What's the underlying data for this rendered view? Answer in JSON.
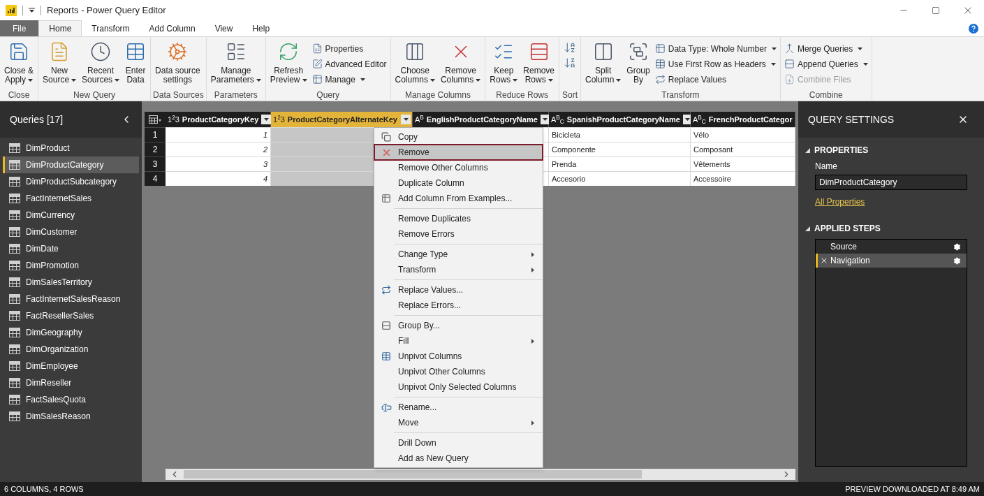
{
  "window": {
    "title": "Reports - Power Query Editor"
  },
  "tabs": [
    {
      "label": "File",
      "kind": "file",
      "selected": false
    },
    {
      "label": "Home",
      "kind": "tab",
      "selected": true
    },
    {
      "label": "Transform",
      "kind": "tab",
      "selected": false
    },
    {
      "label": "Add Column",
      "kind": "tab",
      "selected": false
    },
    {
      "label": "View",
      "kind": "tab",
      "selected": false
    },
    {
      "label": "Help",
      "kind": "tab",
      "selected": false
    }
  ],
  "ribbon": [
    {
      "label": "Close",
      "items": [
        {
          "kind": "large",
          "lines": [
            "Close &",
            "Apply"
          ],
          "dropdown": true
        }
      ]
    },
    {
      "label": "New Query",
      "items": [
        {
          "kind": "large",
          "lines": [
            "New",
            "Source"
          ],
          "dropdown": true
        },
        {
          "kind": "large",
          "lines": [
            "Recent",
            "Sources"
          ],
          "dropdown": true
        },
        {
          "kind": "large",
          "lines": [
            "Enter",
            "Data"
          ],
          "dropdown": false
        }
      ]
    },
    {
      "label": "Data Sources",
      "items": [
        {
          "kind": "large",
          "lines": [
            "Data source",
            "settings"
          ],
          "dropdown": false
        }
      ]
    },
    {
      "label": "Parameters",
      "items": [
        {
          "kind": "large",
          "lines": [
            "Manage",
            "Parameters"
          ],
          "dropdown": true
        }
      ]
    },
    {
      "label": "Query",
      "items": [
        {
          "kind": "large",
          "lines": [
            "Refresh",
            "Preview"
          ],
          "dropdown": true
        },
        {
          "kind": "stack",
          "small": [
            {
              "label": "Properties",
              "dropdown": false,
              "disabled": false
            },
            {
              "label": "Advanced Editor",
              "dropdown": false,
              "disabled": false
            },
            {
              "label": "Manage",
              "dropdown": true,
              "disabled": false
            }
          ]
        }
      ]
    },
    {
      "label": "Manage Columns",
      "items": [
        {
          "kind": "large",
          "lines": [
            "Choose",
            "Columns"
          ],
          "dropdown": true
        },
        {
          "kind": "large",
          "lines": [
            "Remove",
            "Columns"
          ],
          "dropdown": true
        }
      ]
    },
    {
      "label": "Reduce Rows",
      "items": [
        {
          "kind": "large",
          "lines": [
            "Keep",
            "Rows"
          ],
          "dropdown": true
        },
        {
          "kind": "large",
          "lines": [
            "Remove",
            "Rows"
          ],
          "dropdown": true
        }
      ]
    },
    {
      "label": "Sort",
      "items": [
        {
          "kind": "sort"
        }
      ]
    },
    {
      "label": "Transform",
      "items": [
        {
          "kind": "large",
          "lines": [
            "Split",
            "Column"
          ],
          "dropdown": true
        },
        {
          "kind": "large",
          "lines": [
            "Group",
            "By"
          ],
          "dropdown": false
        },
        {
          "kind": "stack",
          "small": [
            {
              "label": "Data Type: Whole Number",
              "dropdown": true,
              "disabled": false
            },
            {
              "label": "Use First Row as Headers",
              "dropdown": true,
              "disabled": false
            },
            {
              "label": "Replace Values",
              "dropdown": false,
              "disabled": false
            }
          ]
        }
      ]
    },
    {
      "label": "Combine",
      "items": [
        {
          "kind": "stack",
          "small": [
            {
              "label": "Merge Queries",
              "dropdown": true,
              "disabled": false
            },
            {
              "label": "Append Queries",
              "dropdown": true,
              "disabled": false
            },
            {
              "label": "Combine Files",
              "dropdown": false,
              "disabled": true
            }
          ]
        }
      ]
    }
  ],
  "queries": {
    "title": "Queries [17]",
    "items": [
      {
        "name": "DimProduct",
        "selected": false
      },
      {
        "name": "DimProductCategory",
        "selected": true
      },
      {
        "name": "DimProductSubcategory",
        "selected": false
      },
      {
        "name": "FactInternetSales",
        "selected": false
      },
      {
        "name": "DimCurrency",
        "selected": false
      },
      {
        "name": "DimCustomer",
        "selected": false
      },
      {
        "name": "DimDate",
        "selected": false
      },
      {
        "name": "DimPromotion",
        "selected": false
      },
      {
        "name": "DimSalesTerritory",
        "selected": false
      },
      {
        "name": "FactInternetSalesReason",
        "selected": false
      },
      {
        "name": "FactResellerSales",
        "selected": false
      },
      {
        "name": "DimGeography",
        "selected": false
      },
      {
        "name": "DimOrganization",
        "selected": false
      },
      {
        "name": "DimEmployee",
        "selected": false
      },
      {
        "name": "DimReseller",
        "selected": false
      },
      {
        "name": "FactSalesQuota",
        "selected": false
      },
      {
        "name": "DimSalesReason",
        "selected": false
      }
    ]
  },
  "table": {
    "columns": [
      {
        "type_label": "1$^{2}$3",
        "name": "ProductCategoryKey",
        "selected": false
      },
      {
        "type_label": "1$^{2}$3",
        "name": "ProductCategoryAlternateKey",
        "selected": true
      },
      {
        "type_label": "A$^{B}$",
        "name": "EnglishProductCategoryName",
        "selected": false
      },
      {
        "type_label": "A$^{B}$$_{C}$",
        "name": "SpanishProductCategoryName",
        "selected": false
      },
      {
        "type_label": "A$^{B}$$_{C}$",
        "name": "FrenchProductCategor",
        "selected": false
      }
    ],
    "rows": [
      {
        "number": "1",
        "cells": [
          "1",
          null,
          null,
          "Bicicleta",
          "Vélo"
        ]
      },
      {
        "number": "2",
        "cells": [
          "2",
          null,
          null,
          "Componente",
          "Composant"
        ]
      },
      {
        "number": "3",
        "cells": [
          "3",
          null,
          null,
          "Prenda",
          "Vêtements"
        ]
      },
      {
        "number": "4",
        "cells": [
          "4",
          null,
          null,
          "Accesorio",
          "Accessoire"
        ]
      }
    ]
  },
  "context_menu": {
    "sections": [
      [
        {
          "label": "Copy",
          "submenu": false,
          "selected": false
        },
        {
          "label": "Remove",
          "submenu": false,
          "selected": true
        },
        {
          "label": "Remove Other Columns",
          "submenu": false,
          "selected": false
        },
        {
          "label": "Duplicate Column",
          "submenu": false,
          "selected": false
        },
        {
          "label": "Add Column From Examples...",
          "submenu": false,
          "selected": false
        }
      ],
      [
        {
          "label": "Remove Duplicates",
          "submenu": false,
          "selected": false
        },
        {
          "label": "Remove Errors",
          "submenu": false,
          "selected": false
        }
      ],
      [
        {
          "label": "Change Type",
          "submenu": true,
          "selected": false
        },
        {
          "label": "Transform",
          "submenu": true,
          "selected": false
        }
      ],
      [
        {
          "label": "Replace Values...",
          "submenu": false,
          "selected": false
        },
        {
          "label": "Replace Errors...",
          "submenu": false,
          "selected": false
        }
      ],
      [
        {
          "label": "Group By...",
          "submenu": false,
          "selected": false
        },
        {
          "label": "Fill",
          "submenu": true,
          "selected": false
        },
        {
          "label": "Unpivot Columns",
          "submenu": false,
          "selected": false
        },
        {
          "label": "Unpivot Other Columns",
          "submenu": false,
          "selected": false
        },
        {
          "label": "Unpivot Only Selected Columns",
          "submenu": false,
          "selected": false
        }
      ],
      [
        {
          "label": "Rename...",
          "submenu": false,
          "selected": false
        },
        {
          "label": "Move",
          "submenu": true,
          "selected": false
        }
      ],
      [
        {
          "label": "Drill Down",
          "submenu": false,
          "selected": false
        },
        {
          "label": "Add as New Query",
          "submenu": false,
          "selected": false
        }
      ]
    ]
  },
  "query_settings": {
    "title": "QUERY SETTINGS",
    "properties_heading": "PROPERTIES",
    "name_label": "Name",
    "name_value": "DimProductCategory",
    "all_properties_link": "All Properties",
    "steps_heading": "APPLIED STEPS",
    "steps": [
      {
        "name": "Source",
        "selected": false
      },
      {
        "name": "Navigation",
        "selected": true
      }
    ]
  },
  "status_bar": {
    "left": "6 COLUMNS, 4 ROWS",
    "right": "PREVIEW DOWNLOADED AT 8:49 AM"
  }
}
